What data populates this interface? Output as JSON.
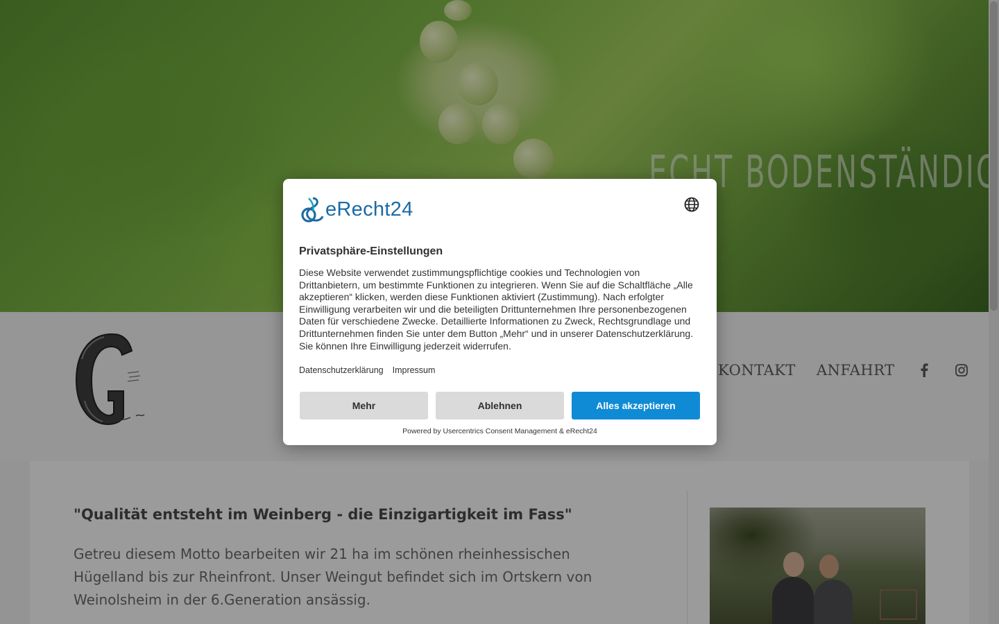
{
  "hero": {
    "tagline": "ECHT BODENSTÄNDIG:"
  },
  "nav": {
    "items": [
      {
        "label": "KONTAKT"
      },
      {
        "label": "ANFAHRT"
      }
    ],
    "social": [
      "facebook-icon",
      "instagram-icon"
    ]
  },
  "content": {
    "quote": "\"Qualität entsteht im Weinberg - die Einzigartigkeit im Fass\"",
    "paragraph": "Getreu diesem Motto bearbeiten wir 21 ha im schönen rheinhessischen Hügelland bis zur Rheinfront. Unser Weingut befindet sich im Ortskern von Weinolsheim in der 6.Generation ansässig."
  },
  "consent": {
    "brand": "eRecht24",
    "title": "Privatsphäre-Einstellungen",
    "body": "Diese Website verwendet zustimmungspflichtige cookies und Technologien von Drittanbietern, um bestimmte Funktionen zu integrieren. Wenn Sie auf die Schaltfläche „Alle akzeptieren“ klicken, werden diese Funktionen aktiviert (Zustimmung). Nach erfolgter Einwilligung verarbeiten wir und die beteiligten Drittunternehmen Ihre personenbezogenen Daten für verschiedene Zwecke. Detaillierte Informationen zu Zweck, Rechtsgrundlage und Drittunternehmen finden Sie unter dem Button „Mehr“ und in unserer Datenschutzerklärung. Sie können Ihre Einwilligung jederzeit widerrufen.",
    "links": {
      "privacy": "Datenschutzerklärung",
      "imprint": "Impressum"
    },
    "buttons": {
      "more": "Mehr",
      "decline": "Ablehnen",
      "accept_all": "Alles akzeptieren"
    },
    "powered_by": "Powered by Usercentrics Consent Management & eRecht24",
    "colors": {
      "accent": "#0f8bd6",
      "brand": "#1b6aa5"
    }
  }
}
